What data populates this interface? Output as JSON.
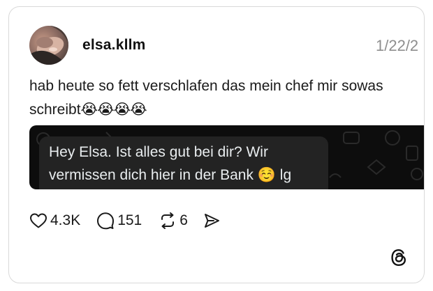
{
  "post": {
    "username": "elsa.kllm",
    "date": "1/22/2",
    "caption_text": "hab heute so fett verschlafen das mein chef mir sowas schreibt",
    "caption_emojis": "😭😭😭😭",
    "media": {
      "message_text": "Hey Elsa. Ist alles gut bei dir? Wir vermissen dich hier in der Bank ☺️ lg Mark"
    }
  },
  "actions": {
    "likes": "4.3K",
    "replies": "151",
    "reposts": "6"
  },
  "icons": {
    "like": "heart-icon",
    "reply": "comment-icon",
    "repost": "repost-icon",
    "share": "send-icon",
    "brand": "threads-logo-icon"
  },
  "colors": {
    "date": "#8e8e8e",
    "media_background": "#0d0d0d",
    "bubble_background": "#232323",
    "bubble_text": "#e9edef"
  }
}
